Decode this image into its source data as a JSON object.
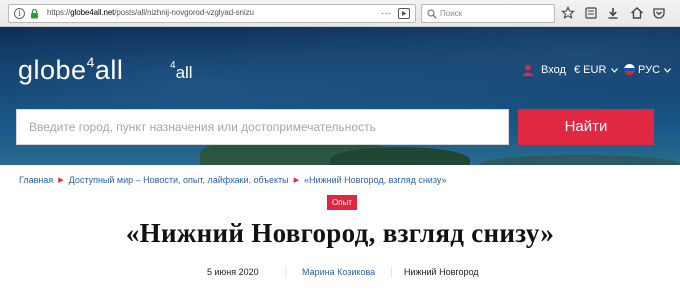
{
  "browser": {
    "url_prefix": "https://",
    "url_domain": "globe4all.net",
    "url_path": "/posts/all/nizhnij-novgorod-vzglyad-snizu",
    "search_placeholder": "Поиск",
    "icons": [
      "info-icon",
      "lock-icon",
      "more-icon",
      "bookmark-page-icon",
      "search-icon",
      "star-icon",
      "reading-list-icon",
      "downloads-icon",
      "home-icon",
      "pocket-icon"
    ]
  },
  "header": {
    "logo_main": "globe",
    "logo_sup": "4",
    "logo_tail": "all",
    "subbrand_sup": "4",
    "subbrand_tail": "all",
    "login_label": "Вход",
    "currency_label": "€ EUR",
    "language_label": "РУС",
    "search_placeholder": "Введите город, пункт назначения или достопримечательность",
    "find_button": "Найти"
  },
  "breadcrumb": [
    "Главная",
    "Доступный мир – Новости, опыт, лайфхаки, объекты",
    "«Нижний Новгород, взгляд снизу»"
  ],
  "article": {
    "badge": "Опыт",
    "title": "«Нижний Новгород, взгляд снизу»",
    "date": "5 июня 2020",
    "author": "Марина Козикова",
    "location": "Нижний Новгород"
  },
  "colors": {
    "accent": "#e02840",
    "link": "#2a63b8",
    "hero_dark": "#0d2e57"
  }
}
